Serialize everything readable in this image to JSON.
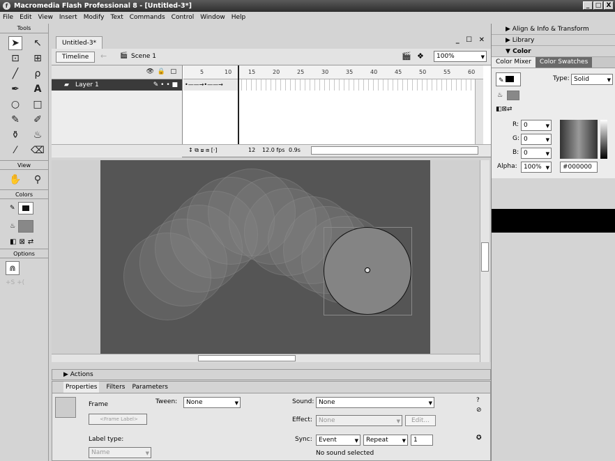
{
  "window": {
    "title": "Macromedia Flash Professional 8 - [Untitled-3*]",
    "controls": [
      "_",
      "□",
      "X"
    ]
  },
  "menu": [
    "File",
    "Edit",
    "View",
    "Insert",
    "Modify",
    "Text",
    "Commands",
    "Control",
    "Window",
    "Help"
  ],
  "tools": {
    "header": "Tools",
    "view_label": "View",
    "colors_label": "Colors",
    "options_label": "Options"
  },
  "document": {
    "tab": "Untitled-3*",
    "controls": "_ ☐ ✕",
    "timeline_button": "Timeline",
    "scene": "Scene 1",
    "zoom": "100%"
  },
  "timeline": {
    "layer_name": "Layer 1",
    "ruler_ticks": [
      "5",
      "10",
      "15",
      "20",
      "25",
      "30",
      "35",
      "40",
      "45",
      "50",
      "55",
      "60"
    ],
    "current_frame": "12",
    "fps": "12.0 fps",
    "elapsed": "0.9s"
  },
  "actions_panel": {
    "title": "Actions"
  },
  "properties": {
    "tabs": [
      "Properties",
      "Filters",
      "Parameters"
    ],
    "frame_label": "Frame",
    "frame_label_placeholder": "<Frame Label>",
    "tween_label": "Tween:",
    "tween_value": "None",
    "sound_label": "Sound:",
    "sound_value": "None",
    "effect_label": "Effect:",
    "effect_value": "None",
    "edit_button": "Edit...",
    "label_type_label": "Label type:",
    "label_type_value": "Name",
    "sync_label": "Sync:",
    "sync_value": "Event",
    "repeat_value": "Repeat",
    "repeat_count": "1",
    "status": "No sound selected"
  },
  "right_panels": {
    "align": "Align & Info & Transform",
    "library": "Library",
    "color": "Color",
    "mixer_tab": "Color Mixer",
    "swatches_tab": "Color Swatches",
    "type_label": "Type:",
    "type_value": "Solid",
    "r_label": "R:",
    "r_value": "0",
    "g_label": "G:",
    "g_value": "0",
    "b_label": "B:",
    "b_value": "0",
    "alpha_label": "Alpha:",
    "alpha_value": "100%",
    "hex_value": "#000000"
  },
  "colors": {
    "stage": "#555555",
    "fill": "#848484",
    "layer_row": "#3a3a3a"
  }
}
